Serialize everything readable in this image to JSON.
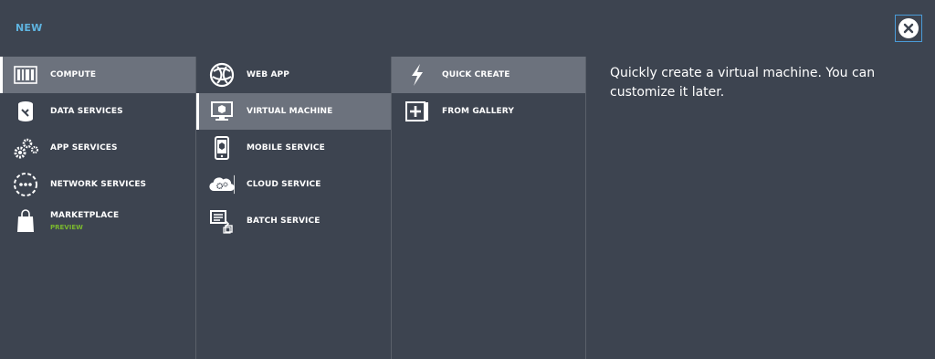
{
  "header": {
    "title": "NEW",
    "close_icon": "close-icon"
  },
  "categories": {
    "items": [
      {
        "label": "COMPUTE",
        "icon": "compute-icon",
        "selected": true
      },
      {
        "label": "DATA SERVICES",
        "icon": "data-services-icon",
        "selected": false
      },
      {
        "label": "APP SERVICES",
        "icon": "gears-icon",
        "selected": false
      },
      {
        "label": "NETWORK SERVICES",
        "icon": "network-icon",
        "selected": false
      },
      {
        "label": "MARKETPLACE",
        "sublabel": "PREVIEW",
        "icon": "shopping-bag-icon",
        "selected": false
      }
    ]
  },
  "compute": {
    "items": [
      {
        "label": "WEB APP",
        "icon": "globe-icon",
        "selected": false
      },
      {
        "label": "VIRTUAL MACHINE",
        "icon": "monitor-icon",
        "selected": true
      },
      {
        "label": "MOBILE SERVICE",
        "icon": "mobile-icon",
        "selected": false
      },
      {
        "label": "CLOUD SERVICE",
        "icon": "cloud-gear-icon",
        "selected": false
      },
      {
        "label": "BATCH SERVICE",
        "icon": "batch-icon",
        "selected": false
      }
    ]
  },
  "vm_options": {
    "items": [
      {
        "label": "QUICK CREATE",
        "icon": "lightning-icon",
        "selected": true
      },
      {
        "label": "FROM GALLERY",
        "icon": "gallery-add-icon",
        "selected": false
      }
    ]
  },
  "description": "Quickly create a virtual machine. You can customize it later.",
  "colors": {
    "background": "#3d4450",
    "selected": "#6c727d",
    "title_accent": "#5fb4e0",
    "preview_green": "#7ab82e",
    "close_border": "#4a9bd8"
  }
}
